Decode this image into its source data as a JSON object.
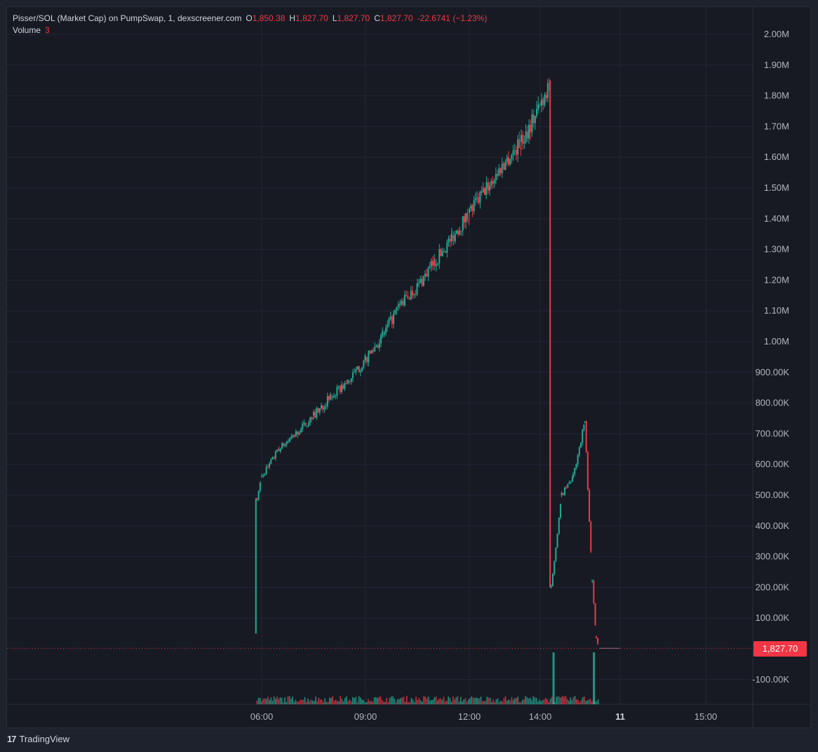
{
  "legend": {
    "title": "Pisser/SOL (Market Cap) on PumpSwap, 1, dexscreener.com",
    "open_key": "O",
    "open": "1,850.38",
    "high_key": "H",
    "high": "1,827.70",
    "low_key": "L",
    "low": "1,827.70",
    "close_key": "C",
    "close": "1,827.70",
    "change": "-22.6741 (−1.23%)",
    "volume_label": "Volume",
    "volume_value": "3"
  },
  "price_tag": "1,827.70",
  "footer": {
    "logo": "17",
    "brand": "TradingView"
  },
  "colors": {
    "background": "#171a23",
    "grid": "#232734",
    "up": "#22ab94",
    "down": "#f23645",
    "axis_text": "#b2b5be"
  },
  "chart_data": {
    "type": "candlestick",
    "title": "Pisser/SOL (Market Cap) on PumpSwap, 1, dexscreener.com",
    "y_unit": "market cap (USD)",
    "ylim": [
      -180000,
      2050000
    ],
    "y_ticks": [
      2000000,
      1900000,
      1800000,
      1700000,
      1600000,
      1500000,
      1400000,
      1300000,
      1200000,
      1100000,
      1000000,
      900000,
      800000,
      700000,
      600000,
      500000,
      400000,
      300000,
      200000,
      100000,
      -100000
    ],
    "y_tick_labels": [
      "2.00M",
      "1.90M",
      "1.80M",
      "1.70M",
      "1.60M",
      "1.50M",
      "1.40M",
      "1.30M",
      "1.20M",
      "1.10M",
      "1.00M",
      "900.00K",
      "800.00K",
      "700.00K",
      "600.00K",
      "500.00K",
      "400.00K",
      "300.00K",
      "200.00K",
      "100.00K",
      "-100.00K"
    ],
    "x_ticks": [
      "06:00",
      "09:00",
      "12:00",
      "14:00",
      "11",
      "15:00"
    ],
    "grid": true,
    "last_price": 1827.7,
    "series": [
      {
        "name": "Market Cap",
        "x": [
          "05:50",
          "05:52",
          "06:00",
          "06:30",
          "07:00",
          "07:30",
          "08:00",
          "08:30",
          "09:00",
          "09:30",
          "10:00",
          "10:30",
          "11:00",
          "11:30",
          "12:00",
          "12:30",
          "13:00",
          "13:30",
          "14:00",
          "14:20",
          "14:22",
          "14:40",
          "15:00",
          "15:20",
          "15:33",
          "15:40",
          "15:45"
        ],
        "values": [
          50000,
          490000,
          560000,
          650000,
          700000,
          760000,
          820000,
          870000,
          940000,
          1020000,
          1120000,
          1180000,
          1260000,
          1340000,
          1420000,
          1500000,
          1580000,
          1650000,
          1760000,
          1850000,
          200000,
          500000,
          560000,
          740000,
          220000,
          40000,
          1827.7
        ]
      }
    ],
    "volume_spikes": [
      {
        "x": "14:26",
        "value": "large"
      },
      {
        "x": "15:36",
        "value": "large"
      }
    ]
  }
}
